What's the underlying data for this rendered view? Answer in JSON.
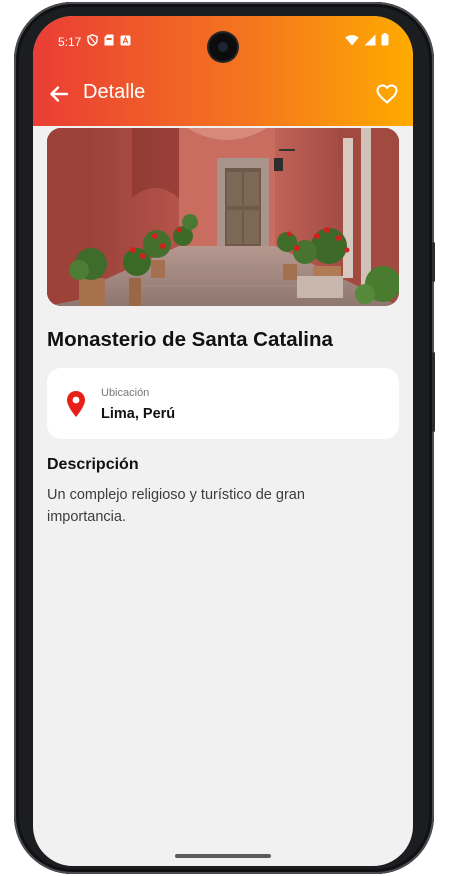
{
  "status_bar": {
    "time": "5:17",
    "icons": [
      "shield-icon",
      "sim-card-icon",
      "text-a-icon",
      "wifi-icon",
      "signal-icon",
      "battery-icon"
    ]
  },
  "app_bar": {
    "title": "Detalle",
    "back_icon": "arrow-back-icon",
    "favorite_icon": "heart-outline-icon"
  },
  "place": {
    "name": "Monasterio de Santa Catalina",
    "location_label": "Ubicación",
    "location_value": "Lima, Perú",
    "description_title": "Descripción",
    "description": "Un complejo religioso y turístico de gran importancia."
  },
  "colors": {
    "gradient_start": "#ea3d36",
    "gradient_end": "#ffab00",
    "pin": "#e8201a",
    "background": "#f1f1f1",
    "card": "#ffffff"
  }
}
